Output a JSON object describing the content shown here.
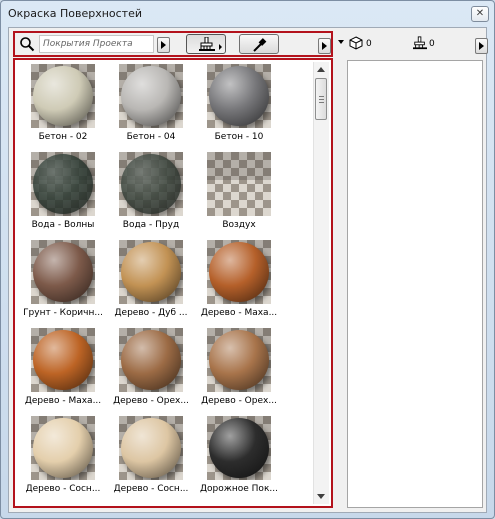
{
  "window": {
    "title": "Окраска Поверхностей",
    "close_label": "✕"
  },
  "toolbar": {
    "filter_placeholder": "Покрытия Проекта"
  },
  "right_toolbar": {
    "surface_count": "0",
    "brush_count": "0"
  },
  "materials": [
    {
      "label": "Бетон - 02",
      "color": "#cfcbb6"
    },
    {
      "label": "Бетон - 04",
      "color": "#b9b7b4"
    },
    {
      "label": "Бетон - 10",
      "color": "#77777a"
    },
    {
      "label": "Вода - Волны",
      "color": "#2d3b33",
      "transparent": true
    },
    {
      "label": "Вода - Пруд",
      "color": "#3a443c",
      "transparent": true
    },
    {
      "label": "Воздух",
      "color": "#ffffff",
      "invisible": true
    },
    {
      "label": "Грунт - Коричн...",
      "color": "#7d5a4a"
    },
    {
      "label": "Дерево - Дуб ...",
      "color": "#c29254"
    },
    {
      "label": "Дерево - Маха...",
      "color": "#b5602a"
    },
    {
      "label": "Дерево - Маха...",
      "color": "#bd6425"
    },
    {
      "label": "Дерево - Орех...",
      "color": "#9c6b45"
    },
    {
      "label": "Дерево - Орех...",
      "color": "#a8744b"
    },
    {
      "label": "Дерево - Сосн...",
      "color": "#e4cfac"
    },
    {
      "label": "Дерево - Сосн...",
      "color": "#ddc6a3"
    },
    {
      "label": "Дорожное Пок...",
      "color": "#2d2d2d"
    }
  ]
}
